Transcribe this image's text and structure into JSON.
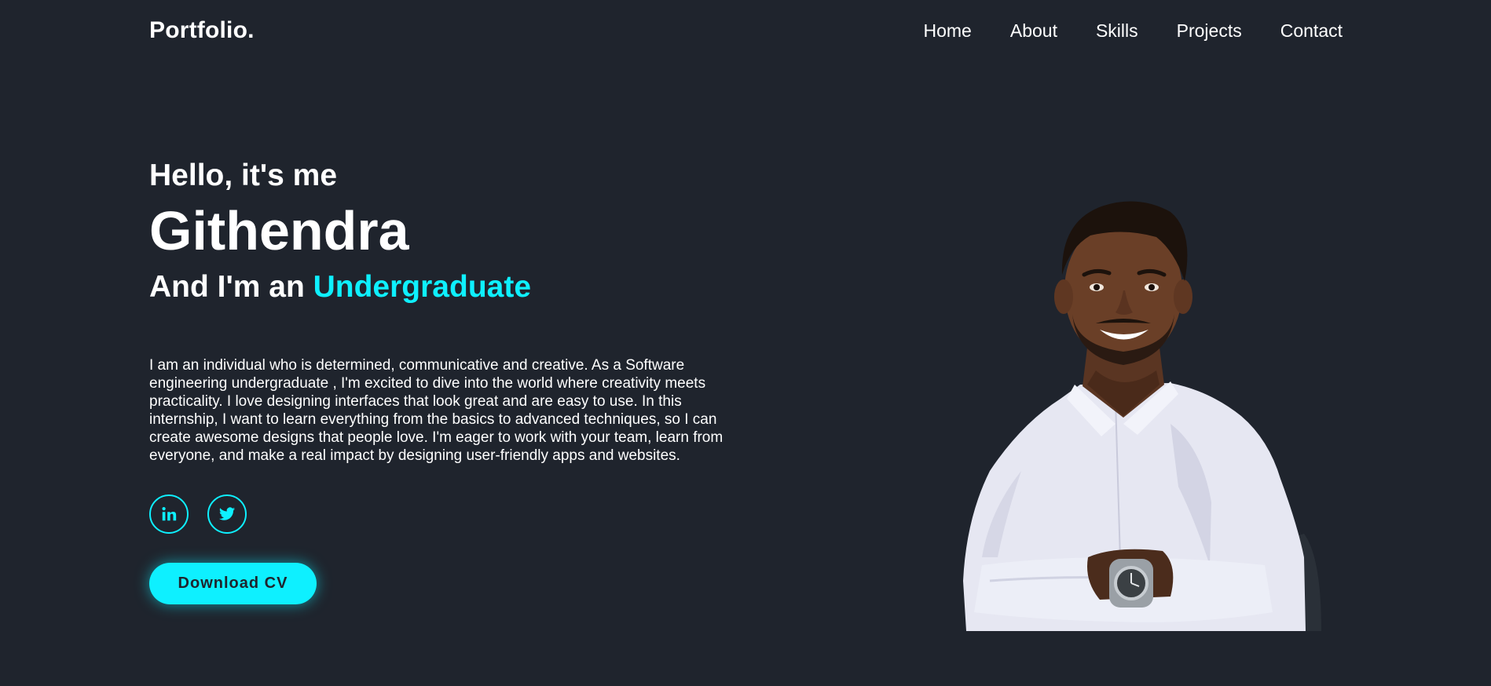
{
  "header": {
    "logo": "Portfolio.",
    "nav": [
      "Home",
      "About",
      "Skills",
      "Projects",
      "Contact"
    ]
  },
  "hero": {
    "greeting": "Hello, it's me",
    "name": "Githendra",
    "role_prefix": "And I'm an ",
    "role_highlight": "Undergraduate",
    "bio": "I am an individual who is determined, communicative and creative. As a Software engineering undergraduate , I'm excited to dive into the world where creativity meets practicality. I love designing interfaces that look great and are easy to use. In this internship, I want to learn everything from the basics to advanced techniques, so I can create awesome designs that people love. I'm eager to work with your team, learn from everyone, and make a real impact by designing user-friendly apps and websites.",
    "socials": [
      {
        "icon": "linkedin-icon"
      },
      {
        "icon": "twitter-icon"
      }
    ],
    "cta_label": "Download CV"
  },
  "colors": {
    "background": "#1f242d",
    "accent": "#0ef0ff",
    "text": "#ffffff"
  }
}
